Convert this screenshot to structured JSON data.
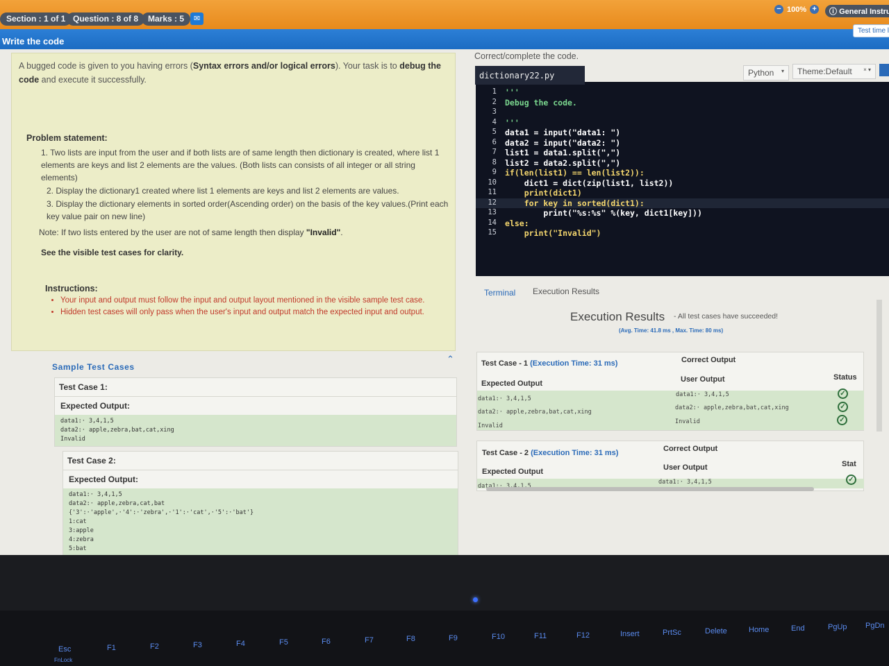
{
  "topbar": {
    "section": "Section : 1 of 1",
    "question": "Question : 8 of 8",
    "marks": "Marks : 5",
    "zoom": "100%",
    "general_instructions": "General Instructio",
    "test_time": "Test time le"
  },
  "header": {
    "title": "Write the code"
  },
  "problem": {
    "intro_1": "A bugged code is given to you having errors (",
    "intro_bold": "Syntax errors and/or logical errors",
    "intro_2": "). Your task is to ",
    "intro_bold2": "debug the code",
    "intro_3": " and execute it successfully.",
    "statement_title": "Problem statement:",
    "items": [
      "1. Two lists are input from the user and if both lists are of same length then dictionary is created, where list 1 elements are keys and list 2 elements are the values. (Both lists can consists of all integer or all string elements)",
      "2. Display the dictionary1 created where list 1 elements are keys and list 2 elements are values.",
      "3. Display the dictionary elements in sorted order(Ascending order) on the basis of the key values.(Print each key value pair on new line)"
    ],
    "note_prefix": "Note: If two lists entered by the user are not of same length then display ",
    "note_bold": "\"Invalid\"",
    "note_suffix": ".",
    "see_visible": "See the visible test cases for clarity.",
    "instructions_title": "Instructions:",
    "instructions": [
      "Your input and output must follow the input and output layout mentioned in the visible sample test case.",
      "Hidden test cases will only pass when the user's input and output match the expected input and output."
    ]
  },
  "samples": {
    "title": "Sample  Test  Cases",
    "cases": [
      {
        "label": "Test Case 1:",
        "expected_label": "Expected Output:",
        "output": "data1:· 3,4,1,5\ndata2:· apple,zebra,bat,cat,xing\nInvalid"
      },
      {
        "label": "Test Case 2:",
        "expected_label": "Expected Output:",
        "output": "data1:· 3,4,1,5\ndata2:· apple,zebra,cat,bat\n{'3':·'apple',·'4':·'zebra',·'1':·'cat',·'5':·'bat'}\n1:cat\n3:apple\n4:zebra\n5:bat"
      }
    ]
  },
  "editor": {
    "label": "Correct/complete the code.",
    "filename": "dictionary22.py",
    "language": "Python",
    "theme": "Theme:Default",
    "lines": [
      {
        "n": "1",
        "t": "'''",
        "c": "#7bd88f"
      },
      {
        "n": "2",
        "t": "Debug the code.",
        "c": "#7bd88f"
      },
      {
        "n": "3",
        "t": "",
        "c": "#ffffff"
      },
      {
        "n": "4",
        "t": "'''",
        "c": "#7bd88f"
      },
      {
        "n": "5",
        "t": "data1 = input(\"data1: \")",
        "c": "#ffffff"
      },
      {
        "n": "6",
        "t": "data2 = input(\"data2: \")",
        "c": "#ffffff"
      },
      {
        "n": "7",
        "t": "list1 = data1.split(\",\")",
        "c": "#ffffff"
      },
      {
        "n": "8",
        "t": "list2 = data2.split(\",\")",
        "c": "#ffffff"
      },
      {
        "n": "9",
        "t": "if(len(list1) == len(list2)):",
        "c": "#f5d76e"
      },
      {
        "n": "10",
        "t": "    dict1 = dict(zip(list1, list2))",
        "c": "#ffffff"
      },
      {
        "n": "11",
        "t": "    print(dict1)",
        "c": "#f5d76e"
      },
      {
        "n": "12",
        "t": "    for key in sorted(dict1):",
        "c": "#f5d76e"
      },
      {
        "n": "13",
        "t": "        print(\"%s:%s\" %(key, dict1[key]))",
        "c": "#ffffff"
      },
      {
        "n": "14",
        "t": "else:",
        "c": "#f5d76e"
      },
      {
        "n": "15",
        "t": "    print(\"Invalid\")",
        "c": "#f5d76e"
      }
    ]
  },
  "tabs": {
    "terminal": "Terminal",
    "execution": "Execution Results"
  },
  "results": {
    "title": "Execution Results",
    "message": "- All test cases have succeeded!",
    "avg_time": "(Avg. Time: 41.8 ms , Max. Time: 80 ms)",
    "status_label": "Status",
    "cases": [
      {
        "label": "Test Case - 1",
        "exec_time": "(Execution Time: 31 ms)",
        "correct_output": "Correct Output",
        "expected_output": "Expected Output",
        "user_output": "User Output",
        "expected_lines": [
          "data1:· 3,4,1,5",
          "data2:· apple,zebra,bat,cat,xing",
          "Invalid"
        ],
        "user_lines": [
          "data1:· 3,4,1,5",
          "data2:· apple,zebra,bat,cat,xing",
          "Invalid"
        ]
      },
      {
        "label": "Test Case - 2",
        "exec_time": "(Execution Time: 31 ms)",
        "correct_output": "Correct Output",
        "expected_output": "Expected Output",
        "user_output": "User Output",
        "status_label": "Stat",
        "expected_lines": [
          "data1:· 3,4,1,5"
        ],
        "user_lines": [
          "data1:· 3,4,1,5"
        ]
      }
    ]
  },
  "keyboard": {
    "keys": [
      "Esc",
      "FnLock",
      "F1",
      "F2",
      "F3",
      "F4",
      "F5",
      "F6",
      "F7",
      "F8",
      "F9",
      "F10",
      "F11",
      "F12",
      "Insert",
      "PrtSc",
      "Delete",
      "Home",
      "End",
      "PgUp",
      "PgDn"
    ]
  },
  "colors": {
    "orange": "#e88a1c",
    "blue": "#1c6cc3",
    "editor_bg": "#0f1320",
    "pass_green": "#d5e6cc"
  }
}
